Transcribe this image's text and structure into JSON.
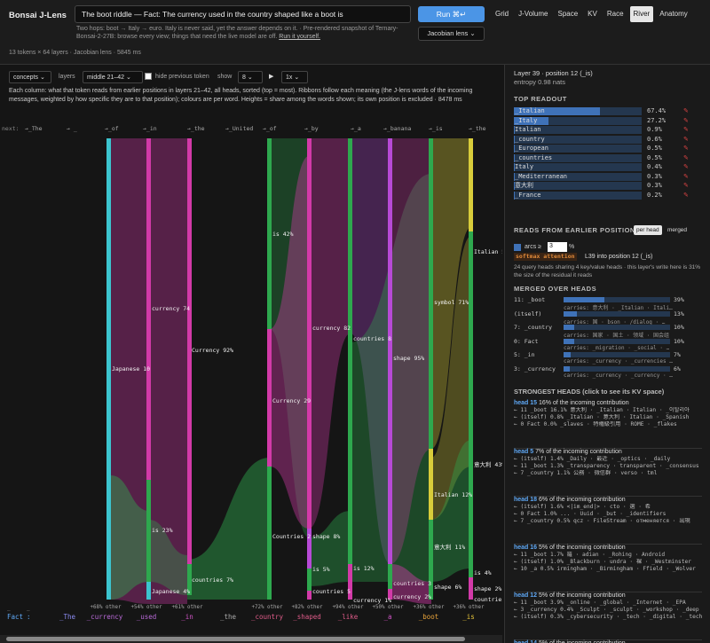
{
  "app": {
    "title": "Bonsai J-Lens"
  },
  "prompt": "The boot riddle — Fact: The currency used in the country shaped like a boot is",
  "note": "Two hops: boot → Italy → euro. Italy is never said, yet the answer depends on it. · Pre-rendered snapshot of Ternary-Bonsai-2-27B: browse every view; things that need the live model are off.",
  "note_link": "Run it yourself.",
  "run_label": "Run ⌘↵",
  "lens_label": "Jacobian lens ⌄",
  "views": [
    "Grid",
    "J-Volume",
    "Space",
    "KV",
    "Race",
    "River",
    "Anatomy"
  ],
  "active_view": "River",
  "token_info": "13 tokens × 64 layers · Jacobian lens · 5845 ms",
  "controls": {
    "mode": "concepts ⌄",
    "layers_label": "layers",
    "layers": "middle 21–42 ⌄",
    "hide_prev": "hide previous token",
    "show_label": "show",
    "show": "8 ⌄",
    "play": "▶",
    "speed": "1x ⌄"
  },
  "description": "Each column: what that token reads from earlier positions in layers 21–42, all heads, sorted (top = most). Ribbons follow each meaning (the J-lens words of the incoming messages, weighted by how specific they are to that position); colours are per word. Heights = share among the words shown; its own position is excluded · 8478 ms",
  "river": {
    "next_label": "next:",
    "next_tokens": [
      "→_The",
      "→ _",
      "→_of",
      "→_in",
      "→_the",
      "→_United",
      "→_of",
      "→_by",
      "→_a",
      "→_banana",
      "→_is",
      "→_the"
    ],
    "bottom_tokens": [
      "Fact",
      ":",
      "_The",
      "_currency",
      "_used",
      "_in",
      "_the",
      "_country",
      "_shaped",
      "_like",
      "_a",
      "_boot",
      "_is"
    ],
    "other_labels": [
      "+68% other",
      "+54% other",
      "+61% other",
      "+72% other",
      "+82% other",
      "+94% other",
      "+50% other",
      "+36% other",
      "+36% other"
    ],
    "labels": [
      "Japanese 10",
      "currency 74",
      "Currency 92%",
      "is 23%",
      "Japanese 4%",
      "countries 7%",
      "is 42%",
      "Currency 29",
      "Countries 2",
      "currency 82",
      "shape 8%",
      "is 5%",
      "countries 5",
      "countries 8",
      "is 12%",
      "currency 1%",
      "shape 95%",
      "countries 3",
      "currency 2%",
      "symbol 71%",
      "Italian 12%",
      "意大利 11%",
      "shape 6%",
      "Italian 5",
      "意大利 43%",
      "is 4%",
      "shape 2%",
      "countries"
    ]
  },
  "side": {
    "layer_title": "Layer 39 · position 12 (_is)",
    "entropy": "entropy 0.98 nats",
    "top_readout_title": "TOP READOUT",
    "top_readout": [
      {
        "token": "_Italian",
        "pct": "67.4%",
        "frac": 0.674
      },
      {
        "token": "_Italy",
        "pct": "27.2%",
        "frac": 0.272
      },
      {
        "token": "Italian",
        "pct": "0.9%",
        "frac": 0.009
      },
      {
        "token": "_country",
        "pct": "0.6%",
        "frac": 0.006
      },
      {
        "token": "_European",
        "pct": "0.5%",
        "frac": 0.005
      },
      {
        "token": "_countries",
        "pct": "0.5%",
        "frac": 0.005
      },
      {
        "token": "Italy",
        "pct": "0.4%",
        "frac": 0.004
      },
      {
        "token": "_Mediterranean",
        "pct": "0.3%",
        "frac": 0.003
      },
      {
        "token": "意大利",
        "pct": "0.3%",
        "frac": 0.003
      },
      {
        "token": "_France",
        "pct": "0.2%",
        "frac": 0.002
      }
    ],
    "reads_title": "READS FROM EARLIER POSITIONS",
    "per_head": "per head",
    "merged": "merged",
    "arcs_label": "arcs ≥",
    "arcs_value": "3",
    "arcs_unit": "%",
    "softmax_badge": "softmax attention",
    "softmax_text": "L39 into position 12 (_is)",
    "heads_text": "24 query heads sharing 4 key/value heads · this layer's write here is 31% the size of the residual it reads",
    "merged_title": "MERGED OVER HEADS",
    "merged_rows": [
      {
        "label": "11: _boot",
        "pct": "39%",
        "frac": 0.39,
        "carries": "carries: 意大利 · _Italian · Itali…"
      },
      {
        "label": "(itself)",
        "pct": "13%",
        "frac": 0.13,
        "carries": "carries: 国 · bson · /dialog · …"
      },
      {
        "label": "7: _country",
        "pct": "10%",
        "frac": 0.1,
        "carries": "carries: 国家 · 国土 · 领域 · 国会组"
      },
      {
        "label": "0: Fact",
        "pct": "10%",
        "frac": 0.1,
        "carries": "carries: _migration · _social · …"
      },
      {
        "label": "5: _in",
        "pct": "7%",
        "frac": 0.07,
        "carries": "carries: _currency · _currencies …"
      },
      {
        "label": "3: _currency",
        "pct": "6%",
        "frac": 0.06,
        "carries": "carries: _currency · _currency · …"
      }
    ],
    "strongest_title": "STRONGEST HEADS (click to see its KV space)",
    "heads": [
      {
        "name": "head 15",
        "text": "16% of the incoming contribution",
        "lines": [
          "← 11 _boot  16.1%  意大利 · _Italian · Italian · _이탈리아",
          "← (itself)  0.8%  _Italian · 意大利 · Italian · _Spanish",
          "← 0 Fact  0.0%  _slaves · 特権級引用 · ROME · _flakes"
        ]
      },
      {
        "name": "head 5",
        "text": "7% of the incoming contribution",
        "lines": [
          "← (itself)  1.4%  _Daily · 最近 · _optics · _daily",
          "← 11 _boot  1.3%  _transparency · transparent · _consensus · 透明的",
          "← 7 _country  1.1%  公務 · 微信群 · verso · tml"
        ]
      },
      {
        "name": "head 18",
        "text": "6% of the incoming contribution",
        "lines": [
          "← (itself)  1.6%  <|im_end|> · cto · 選 · 希",
          "← 0 Fact  1.0%  ... · Uuid · _but · _identifiers",
          "← 7 _country  0.5%  qcz · FileStream · отменяется · 出現"
        ]
      },
      {
        "name": "head 16",
        "text": "5% of the incoming contribution",
        "lines": [
          "← 11 _boot  1.7%  羅 · adian · _Rohing · Android",
          "← (itself)  1.0%  _Blackburn · undra · 裸 · _Westminster",
          "← 10 _a  0.5%  irmingham · _Birmingham · Ffield · _Wolver"
        ]
      },
      {
        "name": "head 12",
        "text": "5% of the incoming contribution",
        "lines": [
          "← 11 _boot  3.9%  _online · _global · _Internet · _EPA",
          "← 3 _currency  0.4%  _Sculpt · _sculpt · _workshop · _deep",
          "← (itself)  0.3%  _cybersecurity · _tech · _digital · _technologies"
        ]
      },
      {
        "name": "head 14",
        "text": "5% of the incoming contribution",
        "lines": []
      }
    ]
  },
  "colors": {
    "accent": "#4b95e6",
    "ribbon_green": "#2ea84e",
    "ribbon_magenta": "#d23aa8",
    "ribbon_cyan": "#3cc4cf",
    "ribbon_yellow": "#d8cc3a",
    "ribbon_purple": "#b74ad6"
  }
}
